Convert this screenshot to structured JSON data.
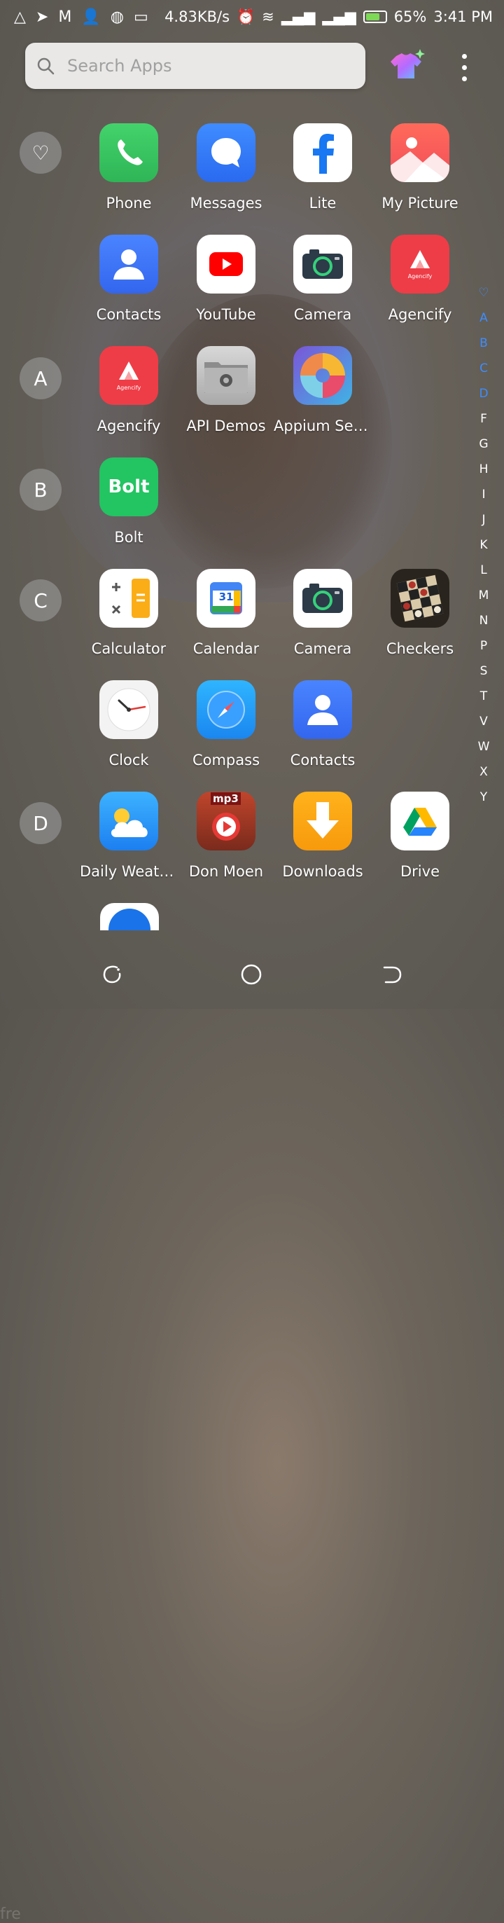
{
  "status": {
    "speed": "4.83KB/s",
    "battery": "65%",
    "time": "3:41 PM",
    "battery_level": 0.65
  },
  "search": {
    "placeholder": "Search Apps"
  },
  "sections": [
    "♡",
    "A",
    "B",
    "C",
    "D"
  ],
  "apps": {
    "phone": "Phone",
    "messages": "Messages",
    "lite": "Lite",
    "mypicture": "My Picture",
    "contacts": "Contacts",
    "youtube": "YouTube",
    "camera": "Camera",
    "agencify": "Agencify",
    "agencify2": "Agencify",
    "apidemos": "API Demos",
    "appium": "Appium Setti...",
    "bolt": "Bolt",
    "calculator": "Calculator",
    "calendar": "Calendar",
    "camera2": "Camera",
    "checkers": "Checkers",
    "clock": "Clock",
    "compass": "Compass",
    "contacts2": "Contacts",
    "dailyweather": "Daily Weather",
    "donmoen": "Don Moen",
    "downloads": "Downloads",
    "drive": "Drive"
  },
  "icon_text": {
    "agencify_word": "Agencify",
    "bolt_word": "Bolt",
    "calendar_day": "31",
    "mp3": "mp3"
  },
  "index": [
    "♡",
    "A",
    "B",
    "C",
    "D",
    "F",
    "G",
    "H",
    "I",
    "J",
    "K",
    "L",
    "M",
    "N",
    "P",
    "S",
    "T",
    "V",
    "W",
    "X",
    "Y"
  ],
  "watermark": "fre"
}
